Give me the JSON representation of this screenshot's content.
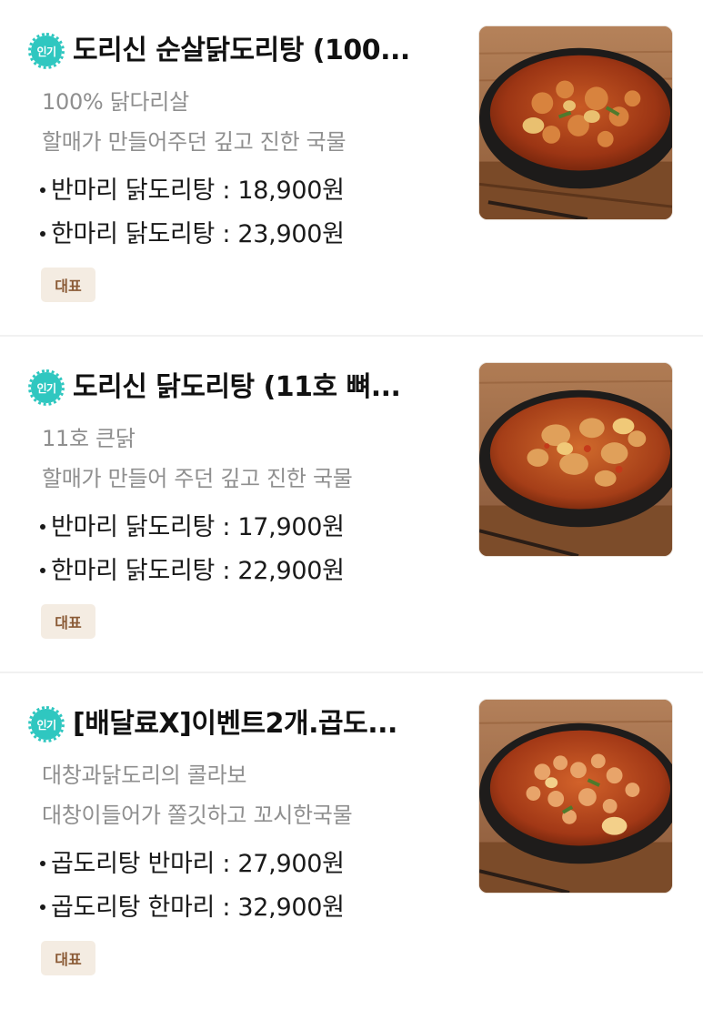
{
  "menu": {
    "items": [
      {
        "badge": "인기",
        "title": "도리신 순살닭도리탕 (100...",
        "desc1": "100% 닭다리살",
        "desc2": "할매가 만들어주던 깊고 진한 국물",
        "price1": "반마리 닭도리탕 : 18,900원",
        "price2": "한마리 닭도리탕 : 23,900원",
        "tag": "대표",
        "image_icon": "chicken-stew-photo"
      },
      {
        "badge": "인기",
        "title": "도리신 닭도리탕 (11호 뼈...",
        "desc1": "11호 큰닭",
        "desc2": "할매가 만들어 주던 깊고 진한 국물",
        "price1": "반마리 닭도리탕 : 17,900원",
        "price2": "한마리 닭도리탕 : 22,900원",
        "tag": "대표",
        "image_icon": "chicken-stew-photo"
      },
      {
        "badge": "인기",
        "title": "[배달료X]이벤트2개.곱도...",
        "desc1": "대창과닭도리의 콜라보",
        "desc2": "대창이들어가 쫄깃하고 꼬시한국물",
        "price1": "곱도리탕 반마리 : 27,900원",
        "price2": "곱도리탕 한마리 : 32,900원",
        "tag": "대표",
        "image_icon": "gopdori-stew-photo"
      }
    ]
  },
  "colors": {
    "popular_badge": "#2fc7c0",
    "tag_bg": "#f4ece2",
    "tag_text": "#8a5a35",
    "desc_text": "#8f8f8f"
  }
}
